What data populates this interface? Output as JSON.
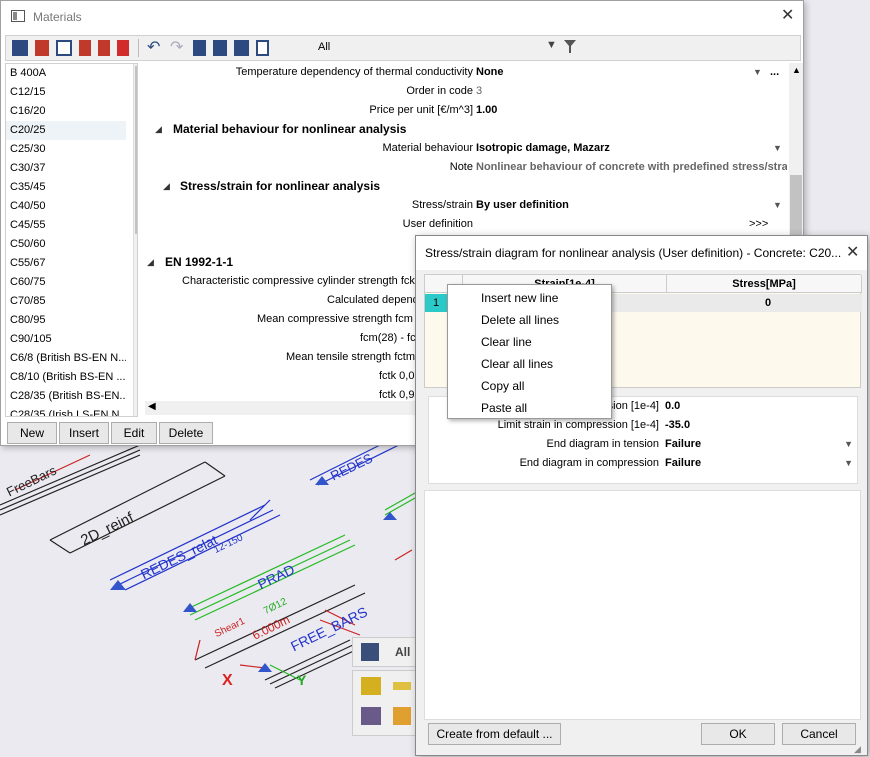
{
  "materials_window": {
    "title": "Materials",
    "filter_value": "All",
    "list_items": [
      "B 400A",
      "C12/15",
      "C16/20",
      "C20/25",
      "C25/30",
      "C30/37",
      "C35/45",
      "C40/50",
      "C45/55",
      "C50/60",
      "C55/67",
      "C60/75",
      "C70/85",
      "C80/95",
      "C90/105",
      "C6/8 (British BS-EN N...",
      "C8/10 (British BS-EN ...",
      "C28/35 (British BS-EN...",
      "C28/35 (Irish I.S-EN N..."
    ],
    "selected_index": 3,
    "buttons": {
      "new": "New",
      "insert": "Insert",
      "edit": "Edit",
      "delete": "Delete"
    },
    "properties": {
      "thermal_label": "Temperature dependency of thermal conductivity",
      "thermal_value": "None",
      "thermal_more": "...",
      "order_label": "Order in code",
      "order_value": "3",
      "price_label": "Price per unit [€/m^3]",
      "price_value": "1.00",
      "section_nonlinear": "Material behaviour for nonlinear analysis",
      "behaviour_label": "Material behaviour",
      "behaviour_value": "Isotropic damage, Mazarz",
      "note_label": "Note",
      "note_value": "Nonlinear behaviour of concrete with predefined stress/strai",
      "section_stress": "Stress/strain for nonlinear analysis",
      "stress_label": "Stress/strain",
      "stress_value": "By user definition",
      "userdef_label": "User definition",
      "userdef_value": ">>>",
      "section_en": "EN 1992-1-1",
      "fck_label": "Characteristic compressive cylinder strength fck",
      "calc_label": "Calculated depend",
      "fcm_label": "Mean compressive strength  fcm",
      "fcm28_label": "fcm(28) - fck",
      "fctm_label": "Mean tensile strength fctm",
      "fctk005_label": "fctk 0,05",
      "fctk095_label": "fctk 0,95"
    }
  },
  "dialog": {
    "title": "Stress/strain diagram for nonlinear analysis (User definition) - Concrete: C20...",
    "col_strain": "Strain[1e-4]",
    "col_stress": "Stress[MPa]",
    "row1_index": "1",
    "row1_stress": "0",
    "limit_tension_label": "Limit strain in tension [1e-4]",
    "limit_tension_value": "0.0",
    "limit_compression_label": "Limit strain in compression [1e-4]",
    "limit_compression_value": "-35.0",
    "end_tension_label": "End diagram in tension",
    "end_tension_value": "Failure",
    "end_compression_label": "End diagram in compression",
    "end_compression_value": "Failure",
    "create_default": "Create from default ...",
    "ok": "OK",
    "cancel": "Cancel"
  },
  "context_menu": [
    "Insert new line",
    "Delete all lines",
    "Clear line",
    "Clear all lines",
    "Copy all",
    "Paste all"
  ],
  "scene": {
    "labels": [
      "FreeBars",
      "2D_reinf",
      "REDES_relat",
      "PRAD",
      "FREE_BARS",
      "REDES",
      "Shear1",
      "6.000m",
      "7Ø12",
      "12-150"
    ],
    "axis_x": "X",
    "axis_y": "Y",
    "mini_toolbar_label": "All"
  }
}
